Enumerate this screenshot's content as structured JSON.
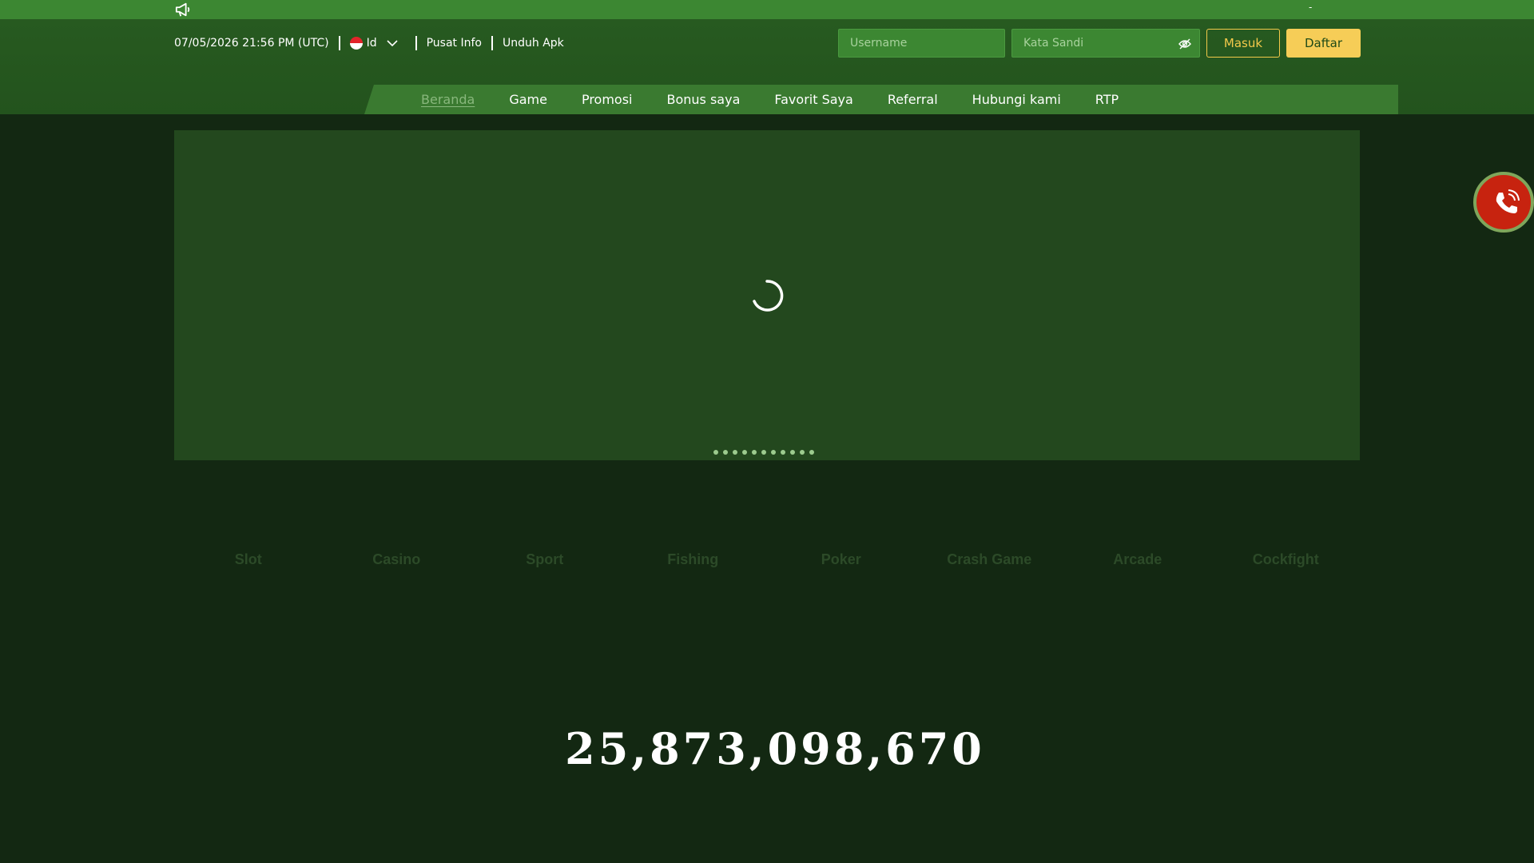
{
  "announcement": {
    "icon": "megaphone-icon",
    "text": "-"
  },
  "header": {
    "datetime": "07/05/2026 21:56 PM (UTC)",
    "language": {
      "flag": "indonesia-flag-icon",
      "label": "Id"
    },
    "links": [
      "Pusat Info",
      "Unduh Apk"
    ],
    "login": {
      "username_placeholder": "Username",
      "password_placeholder": "Kata Sandi",
      "login_label": "Masuk",
      "register_label": "Daftar"
    }
  },
  "nav": {
    "items": [
      "Beranda",
      "Game",
      "Promosi",
      "Bonus saya",
      "Favorit Saya",
      "Referral",
      "Hubungi kami",
      "RTP"
    ],
    "active": "Beranda"
  },
  "banner": {
    "state": "loading",
    "slide_count": 11
  },
  "categories": [
    "Slot",
    "Casino",
    "Sport",
    "Fishing",
    "Poker",
    "Crash Game",
    "Arcade",
    "Cockfight"
  ],
  "jackpot": {
    "value": "25,873,098,670"
  },
  "colors": {
    "topbar": "#3c8732",
    "header": "#275a20",
    "page_background": "#132812",
    "accent_yellow": "#f6cd57",
    "call_button": "#c7230f"
  }
}
